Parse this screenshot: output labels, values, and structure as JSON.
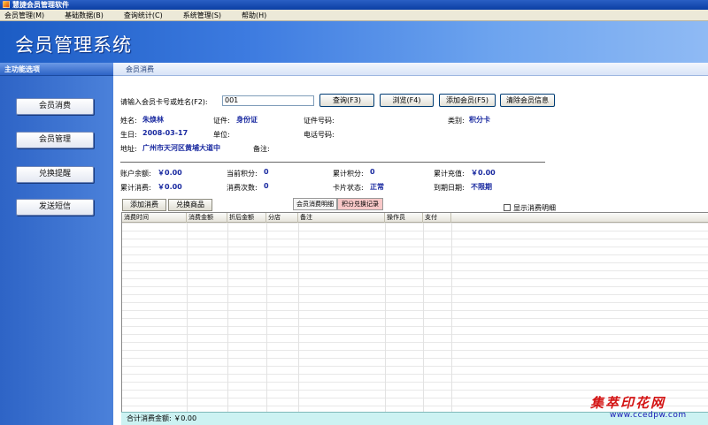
{
  "window": {
    "title": "慧捷会员管理软件"
  },
  "menu": [
    "会员管理(M)",
    "基础数据(B)",
    "查询统计(C)",
    "系统管理(S)",
    "帮助(H)"
  ],
  "banner": {
    "title": "会员管理系统"
  },
  "sidebar": {
    "header": "主功能选项",
    "items": [
      {
        "label": "会员消费"
      },
      {
        "label": "会员管理"
      },
      {
        "label": "兑换提醒"
      },
      {
        "label": "发送短信"
      }
    ]
  },
  "panel": {
    "title": "会员消费"
  },
  "search": {
    "label": "请输入会员卡号或姓名(F2):",
    "value": "001",
    "buttons": {
      "query": "查询(F3)",
      "browse": "浏览(F4)",
      "add_member": "添加会员(F5)",
      "clear_info": "清除会员信息"
    }
  },
  "member": {
    "name_label": "姓名:",
    "name": "朱焕林",
    "idtype_label": "证件:",
    "idtype": "身份证",
    "idno_label": "证件号码:",
    "idno": "",
    "category_label": "类别:",
    "category": "积分卡",
    "birthday_label": "生日:",
    "birthday": "2008-03-17",
    "unit_label": "单位:",
    "unit": "",
    "phone_label": "电话号码:",
    "phone": "",
    "address_label": "地址:",
    "address": "广州市天河区黄埔大道中",
    "remark_label": "备注:",
    "remark": ""
  },
  "account": {
    "balance_label": "账户余额:",
    "balance": "￥0.00",
    "cur_points_label": "当前积分:",
    "cur_points": "0",
    "total_points_label": "累计积分:",
    "total_points": "0",
    "total_recharge_label": "累计充值:",
    "total_recharge": "￥0.00",
    "total_spend_label": "累计消费:",
    "total_spend": "￥0.00",
    "spend_count_label": "消费次数:",
    "spend_count": "0",
    "card_status_label": "卡片状态:",
    "card_status": "正常",
    "expiry_label": "到期日期:",
    "expiry": "不限期"
  },
  "actions": {
    "add_consume": "添加消费",
    "exchange_goods": "兑换商品"
  },
  "right_tabs": {
    "consume_detail": "会员消费明细",
    "points_record": "积分兑换记录"
  },
  "show_detail_label": "显示消费明细",
  "table": {
    "columns": [
      "消费时间",
      "消费金额",
      "折后金额",
      "分店",
      "备注",
      "操作员",
      "支付"
    ]
  },
  "footer": {
    "total_label": "合计消费金额:",
    "total": "￥0.00"
  },
  "watermark": {
    "text1": "集萃印花网",
    "text2": "www.ccedpw.com"
  },
  "colors": {
    "accent": "#2e64c6",
    "value_text": "#1a2aa0",
    "footer_bg": "#ccf2f2",
    "active_tab": "#f8c8c8"
  }
}
